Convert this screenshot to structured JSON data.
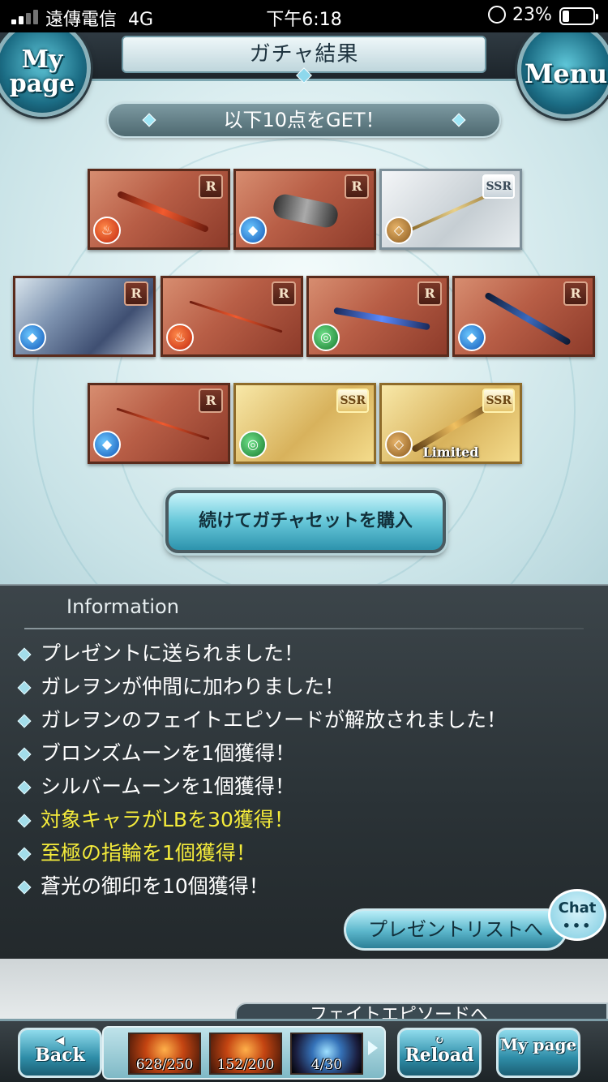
{
  "status_bar": {
    "carrier": "遠傳電信",
    "network": "4G",
    "time": "下午6:18",
    "battery": "23%"
  },
  "header": {
    "title": "ガチャ結果",
    "mypage_label": "My page",
    "menu_label": "Menu"
  },
  "result": {
    "subtitle": "以下10点をGET！",
    "items": [
      {
        "rarity": "R",
        "element": "fire-icon"
      },
      {
        "rarity": "R",
        "element": "water-icon"
      },
      {
        "rarity": "SSR",
        "element": "earth-icon"
      },
      {
        "rarity": "R",
        "element": "water-icon"
      },
      {
        "rarity": "R",
        "element": "fire-icon"
      },
      {
        "rarity": "R",
        "element": "wind-icon"
      },
      {
        "rarity": "R",
        "element": "water-icon"
      },
      {
        "rarity": "R",
        "element": "water-icon"
      },
      {
        "rarity": "SSR",
        "element": "wind-icon"
      },
      {
        "rarity": "SSR",
        "element": "earth-icon",
        "badge": "Limited"
      }
    ],
    "buy_again_label": "続けてガチャセットを購入"
  },
  "information": {
    "title": "Information",
    "messages": [
      {
        "text": "プレゼントに送られました！",
        "highlight": false
      },
      {
        "text": "ガレヲンが仲間に加わりました！",
        "highlight": false
      },
      {
        "text": "ガレヲンのフェイトエピソードが解放されました！",
        "highlight": false
      },
      {
        "text": "ブロンズムーンを1個獲得！",
        "highlight": false
      },
      {
        "text": "シルバームーンを1個獲得！",
        "highlight": false
      },
      {
        "text": "対象キャラがLBを30獲得！",
        "highlight": true
      },
      {
        "text": "至極の指輪を1個獲得！",
        "highlight": true
      },
      {
        "text": "蒼光の御印を10個獲得！",
        "highlight": false
      }
    ],
    "present_list_label": "プレゼントリストへ",
    "chat_label": "Chat",
    "chat_dots": "•••"
  },
  "lower_peek_text": "フェイトエピソードへ",
  "bottom_bar": {
    "back_label": "Back",
    "reload_label": "Reload",
    "mypage_label": "My page",
    "resources": [
      "628/250",
      "152/200",
      "4/30"
    ]
  },
  "colors": {
    "highlight_text": "#f4eb3b",
    "accent": "#5bb6cb"
  }
}
